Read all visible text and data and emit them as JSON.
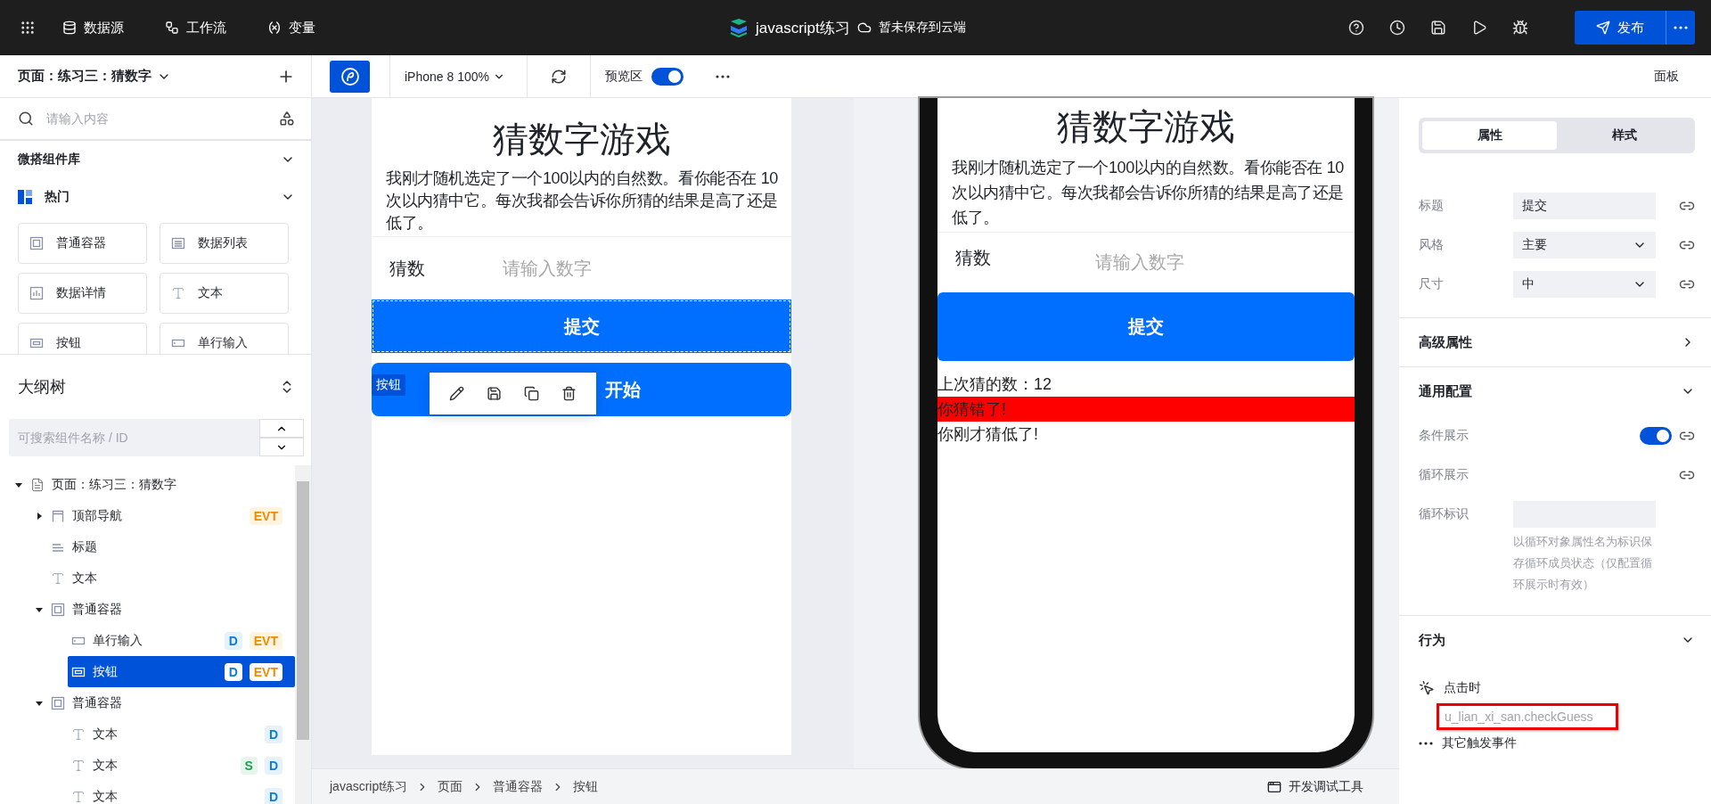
{
  "topbar": {
    "nav": [
      {
        "label": "数据源",
        "kind": "database"
      },
      {
        "label": "工作流",
        "kind": "workflow"
      },
      {
        "label": "变量",
        "kind": "variable"
      }
    ],
    "project": "javascript练习",
    "save_status": "暂未保存到云端",
    "publish": "发布"
  },
  "left_panel": {
    "page_selector": "页面：练习三：猜数字",
    "search_placeholder": "请输入内容",
    "library": {
      "title": "微搭组件库",
      "expanded": true,
      "category": {
        "label": "热门",
        "expanded": true
      },
      "components": [
        {
          "label": "普通容器",
          "kind": "container"
        },
        {
          "label": "数据列表",
          "kind": "list"
        },
        {
          "label": "数据详情",
          "kind": "detail"
        },
        {
          "label": "文本",
          "kind": "text"
        },
        {
          "label": "按钮",
          "kind": "button"
        },
        {
          "label": "单行输入",
          "kind": "input"
        }
      ]
    },
    "outline": {
      "title": "大纲树",
      "search_placeholder": "可搜索组件名称 / ID",
      "tree": [
        {
          "label": "页面：练习三：猜数字",
          "kind": "page",
          "selected": false,
          "expanded": true,
          "children": [
            {
              "label": "顶部导航",
              "kind": "nav",
              "selected": false,
              "expanded": false,
              "badges": [
                {
                  "text": "EVT",
                  "kind": "event"
                }
              ]
            },
            {
              "label": "标题",
              "kind": "title",
              "selected": false
            },
            {
              "label": "文本",
              "kind": "text",
              "selected": false
            },
            {
              "label": "普通容器",
              "kind": "container",
              "selected": false,
              "expanded": true,
              "children": [
                {
                  "label": "单行输入",
                  "kind": "input",
                  "selected": false,
                  "badges": [
                    {
                      "text": "D",
                      "kind": "data"
                    },
                    {
                      "text": "EVT",
                      "kind": "event"
                    }
                  ]
                },
                {
                  "label": "按钮",
                  "kind": "button",
                  "selected": true,
                  "badges": [
                    {
                      "text": "D",
                      "kind": "data"
                    },
                    {
                      "text": "EVT",
                      "kind": "event"
                    }
                  ]
                }
              ]
            },
            {
              "label": "普通容器",
              "kind": "container",
              "selected": false,
              "expanded": true,
              "children": [
                {
                  "label": "文本",
                  "kind": "text",
                  "selected": false,
                  "badges": [
                    {
                      "text": "D",
                      "kind": "data"
                    }
                  ]
                },
                {
                  "label": "文本",
                  "kind": "text",
                  "selected": false,
                  "badges": [
                    {
                      "text": "S",
                      "kind": "state"
                    },
                    {
                      "text": "D",
                      "kind": "data"
                    }
                  ]
                },
                {
                  "label": "文本",
                  "kind": "text",
                  "selected": false,
                  "badges": [
                    {
                      "text": "D",
                      "kind": "data"
                    }
                  ]
                }
              ]
            }
          ]
        }
      ]
    }
  },
  "toolbar": {
    "device": "iPhone 8 100%",
    "preview": {
      "label": "预览区",
      "on": true
    },
    "panel": "面板"
  },
  "editor_canvas": {
    "selection_tag": "按钮",
    "title": "猜数字游戏",
    "intro": "我刚才随机选定了一个100以内的自然数。看你能否在 10 次以内猜中它。每次我都会告诉你所猜的结果是高了还是低了。",
    "guess_label": "猜数",
    "guess_placeholder": "请输入数字",
    "submit": "提交",
    "restart": "开始"
  },
  "preview": {
    "title": "猜数字游戏",
    "intro": "我刚才随机选定了一个100以内的自然数。看你能否在 10 次以内猜中它。每次我都会告诉你所猜的结果是高了还是低了。",
    "guess_label": "猜数",
    "guess_placeholder": "请输入数字",
    "submit": "提交",
    "results": [
      {
        "text": "上次猜的数：12",
        "highlight": false
      },
      {
        "text": "你猜错了!",
        "highlight": true
      },
      {
        "text": "你刚才猜低了!",
        "highlight": false
      }
    ]
  },
  "breadcrumb": [
    "javascript练习",
    "页面",
    "普通容器",
    "按钮"
  ],
  "devtools": "开发调试工具",
  "right_panel": {
    "tabs": [
      {
        "label": "属性",
        "selected": true
      },
      {
        "label": "样式",
        "selected": false
      }
    ],
    "properties": [
      {
        "label": "标题",
        "value": "提交",
        "kind": "input"
      },
      {
        "label": "风格",
        "value": "主要",
        "kind": "select"
      },
      {
        "label": "尺寸",
        "value": "中",
        "kind": "select"
      }
    ],
    "advanced": {
      "title": "高级属性",
      "expanded": false
    },
    "general": {
      "title": "通用配置",
      "expanded": true,
      "rows": [
        {
          "label": "条件展示",
          "kind": "toggle",
          "on": true
        },
        {
          "label": "循环展示",
          "kind": "binding"
        },
        {
          "label": "循环标识",
          "kind": "input",
          "hint": "以循环对象属性名为标识保存循环成员状态（仅配置循环展示时有效）"
        }
      ]
    },
    "behavior": {
      "title": "行为",
      "expanded": true,
      "event": "点击时",
      "handler": "u_lian_xi_san.checkGuess",
      "other": "其它触发事件"
    }
  }
}
